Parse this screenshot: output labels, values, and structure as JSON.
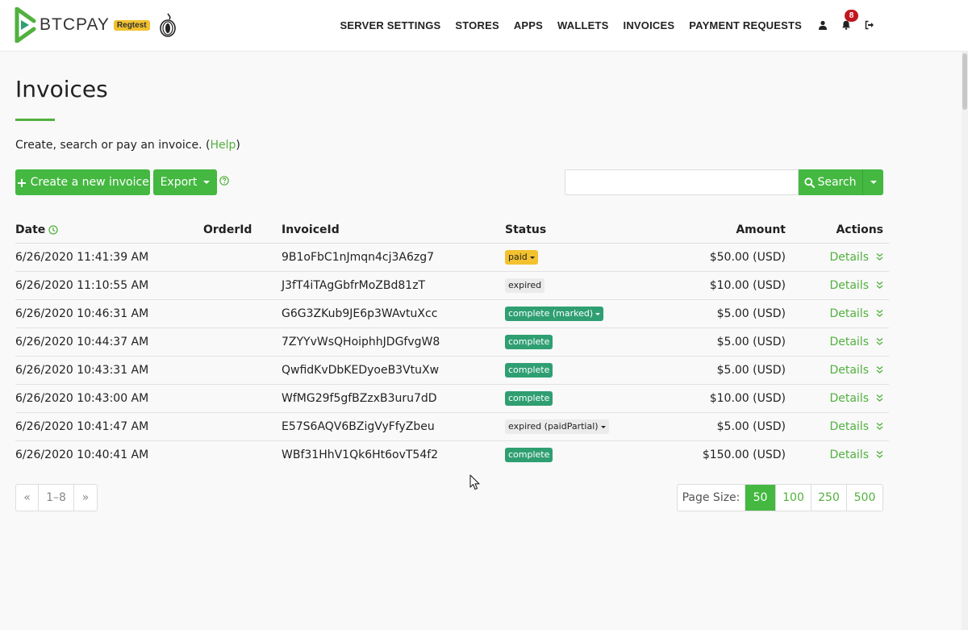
{
  "navbar": {
    "brand_name": "BTCPAY",
    "env_badge": "Regtest",
    "links": [
      "SERVER SETTINGS",
      "STORES",
      "APPS",
      "WALLETS",
      "INVOICES",
      "PAYMENT REQUESTS"
    ],
    "notification_count": "8"
  },
  "page": {
    "title": "Invoices",
    "lead_text": "Create, search or pay an invoice. (",
    "lead_link": "Help",
    "lead_end": ")"
  },
  "toolbar": {
    "create_label": "Create a new invoice",
    "export_label": "Export",
    "search_placeholder": "",
    "search_label": "Search"
  },
  "table": {
    "headers": {
      "date": "Date",
      "order_id": "OrderId",
      "invoice_id": "InvoiceId",
      "status": "Status",
      "amount": "Amount",
      "actions": "Actions"
    },
    "rows": [
      {
        "date": "6/26/2020 11:41:39 AM",
        "order_id": "",
        "invoice_id": "9B1oFbC1nJmqn4cj3A6zg7",
        "status": "paid",
        "status_kind": "paid",
        "dropdown": true,
        "amount": "$50.00 (USD)",
        "action": "Details"
      },
      {
        "date": "6/26/2020 11:10:55 AM",
        "order_id": "",
        "invoice_id": "J3fT4iTAgGbfrMoZBd81zT",
        "status": "expired",
        "status_kind": "expired",
        "dropdown": false,
        "amount": "$10.00 (USD)",
        "action": "Details"
      },
      {
        "date": "6/26/2020 10:46:31 AM",
        "order_id": "",
        "invoice_id": "G6G3ZKub9JE6p3WAvtuXcc",
        "status": "complete (marked)",
        "status_kind": "complete",
        "dropdown": true,
        "amount": "$5.00 (USD)",
        "action": "Details"
      },
      {
        "date": "6/26/2020 10:44:37 AM",
        "order_id": "",
        "invoice_id": "7ZYYvWsQHoiphhJDGfvgW8",
        "status": "complete",
        "status_kind": "complete",
        "dropdown": false,
        "amount": "$5.00 (USD)",
        "action": "Details"
      },
      {
        "date": "6/26/2020 10:43:31 AM",
        "order_id": "",
        "invoice_id": "QwfidKvDbKEDyoeB3VtuXw",
        "status": "complete",
        "status_kind": "complete",
        "dropdown": false,
        "amount": "$5.00 (USD)",
        "action": "Details"
      },
      {
        "date": "6/26/2020 10:43:00 AM",
        "order_id": "",
        "invoice_id": "WfMG29f5gfBZzxB3uru7dD",
        "status": "complete",
        "status_kind": "complete",
        "dropdown": false,
        "amount": "$10.00 (USD)",
        "action": "Details"
      },
      {
        "date": "6/26/2020 10:41:47 AM",
        "order_id": "",
        "invoice_id": "E57S6AQV6BZigVyFfyZbeu",
        "status": "expired (paidPartial)",
        "status_kind": "expired",
        "dropdown": true,
        "amount": "$5.00 (USD)",
        "action": "Details"
      },
      {
        "date": "6/26/2020 10:40:41 AM",
        "order_id": "",
        "invoice_id": "WBf31HhV1Qk6Ht6ovT54f2",
        "status": "complete",
        "status_kind": "complete",
        "dropdown": false,
        "amount": "$150.00 (USD)",
        "action": "Details"
      }
    ]
  },
  "pagination": {
    "prev": "«",
    "range": "1–8",
    "next": "»",
    "page_size_label": "Page Size:",
    "page_sizes": [
      "50",
      "100",
      "250",
      "500"
    ],
    "active_page_size": "50"
  },
  "colors": {
    "accent": "#44b841",
    "link": "#51b13e",
    "paid": "#f2c12e",
    "complete": "#2f9f72",
    "expired": "#ebebeb",
    "notification": "#c0171f"
  },
  "icons": {
    "brand": "btcpay-logo-icon",
    "tor": "tor-onion-icon",
    "user": "user-icon",
    "notifications": "bell-icon",
    "logout": "sign-out-icon",
    "help": "question-circle-icon",
    "search": "search-icon",
    "sort": "clock-icon",
    "expand": "double-chevron-down-icon"
  }
}
